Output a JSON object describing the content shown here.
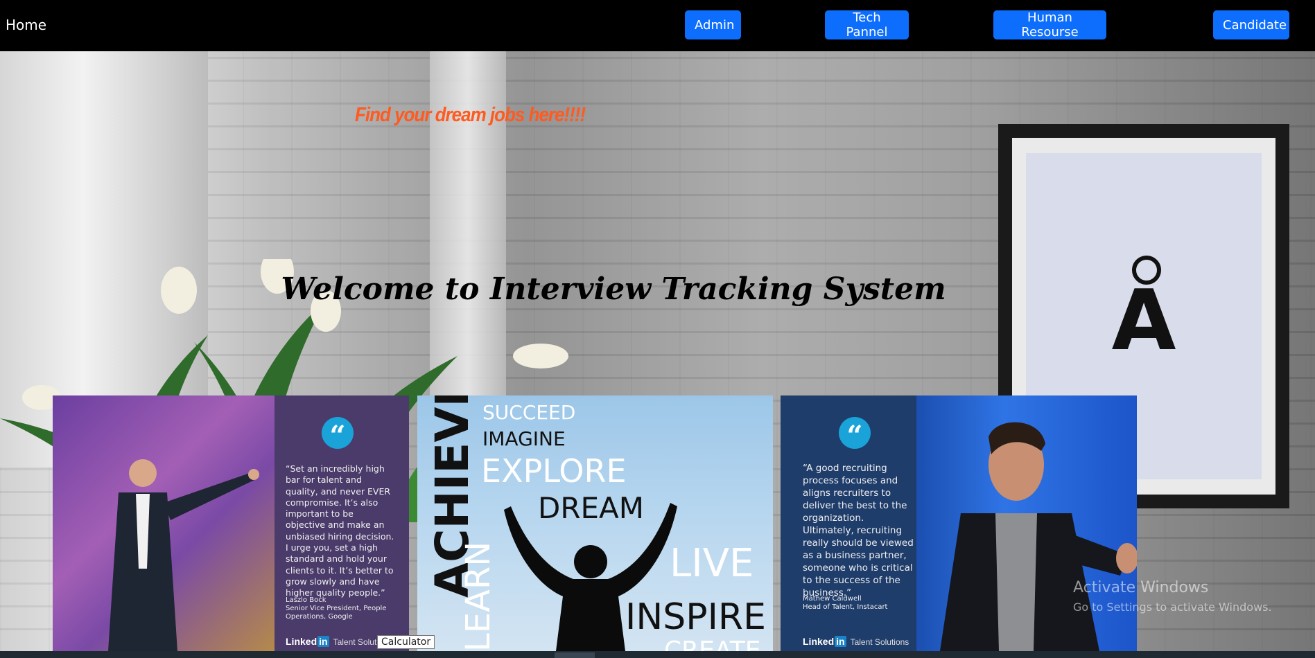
{
  "nav": {
    "home": "Home",
    "buttons": [
      "Admin",
      "Tech Pannel",
      "Human Resourse",
      "Candidate"
    ]
  },
  "hero": {
    "tagline": "Find your dream jobs here!!!!",
    "welcome": "Welcome to Interview Tracking System"
  },
  "cards": {
    "card1": {
      "quote_mark": "“",
      "quote": "“Set an incredibly high bar for talent and quality, and never EVER compromise. It’s also important to be objective and make an unbiased hiring decision. I urge you, set a high standard and hold your clients to it. It’s better to grow slowly and have higher quality people.”",
      "author_name": "Laszlo Bock",
      "author_title": "Senior Vice President, People Operations, Google",
      "brand": "Linked",
      "brand_in": "in",
      "brand_suffix": "Talent Solut"
    },
    "card2": {
      "words": {
        "achieve": "ACHIEVE",
        "learn": "LEARN",
        "succeed": "SUCCEED",
        "imagine": "IMAGINE",
        "explore": "EXPLORE",
        "dream": "DREAM",
        "live": "LIVE",
        "inspire": "INSPIRE",
        "create": "CREATE"
      }
    },
    "card3": {
      "quote_mark": "“",
      "quote": "“A good recruiting process focuses and aligns recruiters to deliver the best to the organization. Ultimately, recruiting really should be viewed as a business partner, someone who is critical to the success of the business.”",
      "author_name": "Mathew Caldwell",
      "author_title": "Head of Talent, Instacart",
      "brand": "Linked",
      "brand_in": "in",
      "brand_suffix": "Talent Solutions"
    }
  },
  "overlay": {
    "activate_title": "Activate Windows",
    "activate_sub": "Go to Settings to activate Windows.",
    "tooltip": "Calculator"
  },
  "colors": {
    "nav_bg": "#000000",
    "button_bg": "#0d6efd",
    "tagline": "#ff5a1f",
    "quote_icon": "#1aa3d9"
  }
}
